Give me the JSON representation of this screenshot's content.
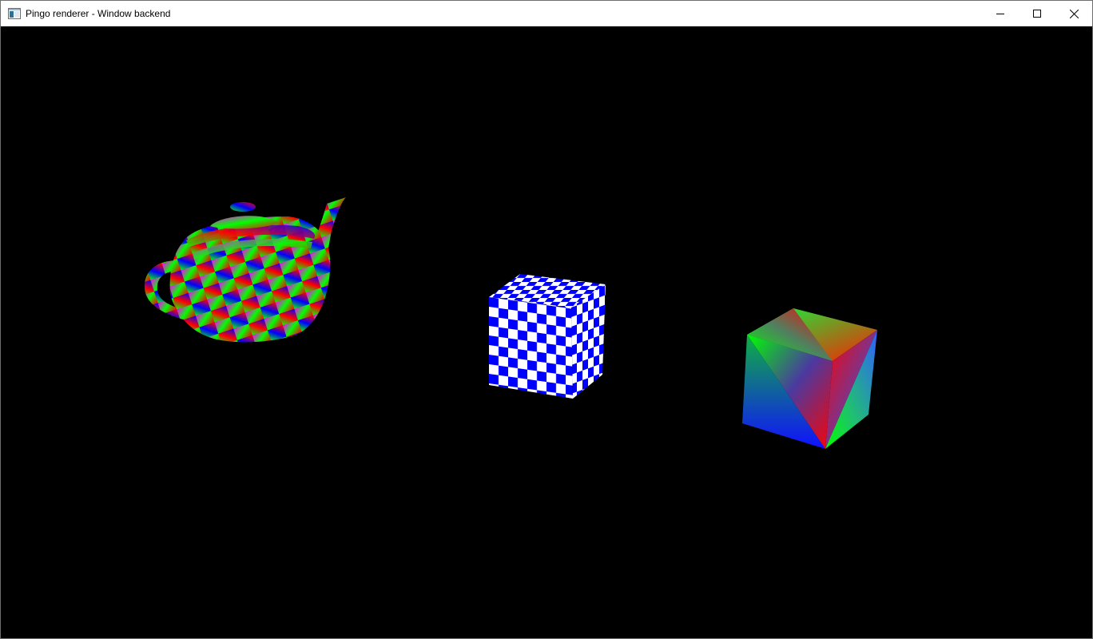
{
  "window": {
    "title": "Pingo renderer - Window backend",
    "icon": "application-window-icon",
    "controls": [
      "minimize-icon",
      "maximize-icon",
      "close-icon"
    ]
  },
  "scene": {
    "background": "#000000",
    "objects": [
      {
        "name": "teapot",
        "shading": "rgb-gradient-triangles"
      },
      {
        "name": "checkered-cube",
        "colors": [
          "#0000ff",
          "#ffffff"
        ]
      },
      {
        "name": "gradient-cube",
        "colors": [
          "#ff0000",
          "#00ff00",
          "#0000ff"
        ]
      }
    ]
  }
}
